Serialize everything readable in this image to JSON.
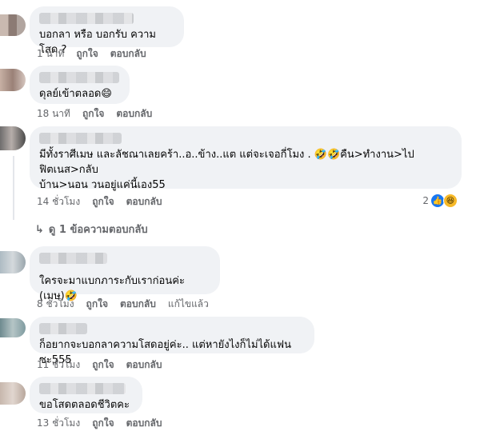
{
  "actions": {
    "like": "ถูกใจ",
    "reply": "ตอบกลับ",
    "edited": "แก้ไขแล้ว"
  },
  "comments": [
    {
      "text": "บอกลา หรือ บอกรับ ความโสด ?",
      "time": "1 นาที"
    },
    {
      "text": "ดุลย์เข้าตลอด😄",
      "time": "18 นาที"
    },
    {
      "text": "มีทั้งราศีเมษ และลัชณาเลยคร้า..อ..ข้าง..แต แต่จะเจอกี่โมง . 🤣🤣คืน>ทำงาน>ไปฟิตเนส>กลับ\nบ้าน>นอน วนอยู่แค่นี้เอง55",
      "time": "14 ชั่วโมง",
      "reactions": {
        "count": "2",
        "icons": [
          "like-icon",
          "haha-icon"
        ]
      }
    },
    {
      "text": "ใครจะมาแบกภาระกับเราก่อนค่ะ (เมษ)🤣",
      "time": "8 ชั่วโมง",
      "edited": true
    },
    {
      "text": "ก็อยากจะบอกลาความโสดอยู่ค่ะ.. แต่หายังไงก็ไม่ได้แฟนซะ555",
      "time": "11 ชั่วโมง"
    },
    {
      "text": "ขอโสดตลอดชีวิตคะ",
      "time": "13 ชั่วโมง"
    }
  ],
  "view_replies": "ดู 1 ข้อความตอบกลับ"
}
